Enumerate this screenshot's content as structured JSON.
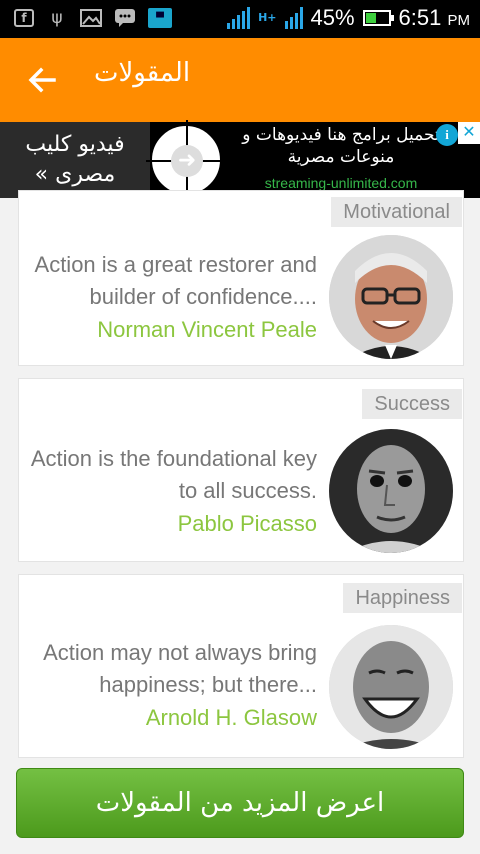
{
  "status_bar": {
    "battery_percent": "45%",
    "battery_level": 0.45,
    "time": "6:51",
    "ampm": "PM",
    "network": "H+"
  },
  "app_bar": {
    "title": "المقولات"
  },
  "ad": {
    "left_text": "فيديو كليب مصرى »",
    "main_text": "تحميل برامج هنا فيديوهات و منوعات مصرية",
    "url": "streaming-unlimited.com"
  },
  "quotes": [
    {
      "category": "Motivational",
      "text": "Action is a great restorer and builder of confidence....",
      "author": "Norman Vincent Peale"
    },
    {
      "category": "Success",
      "text": "Action is the foundational key to all success.",
      "author": "Pablo Picasso"
    },
    {
      "category": "Happiness",
      "text": "Action may not always bring happiness; but there...",
      "author": "Arnold H. Glasow"
    }
  ],
  "more_button": {
    "label": "اعرض المزيد من المقولات"
  },
  "colors": {
    "accent": "#ff8c00",
    "author": "#8cc63f",
    "button": "#5aa82a"
  }
}
